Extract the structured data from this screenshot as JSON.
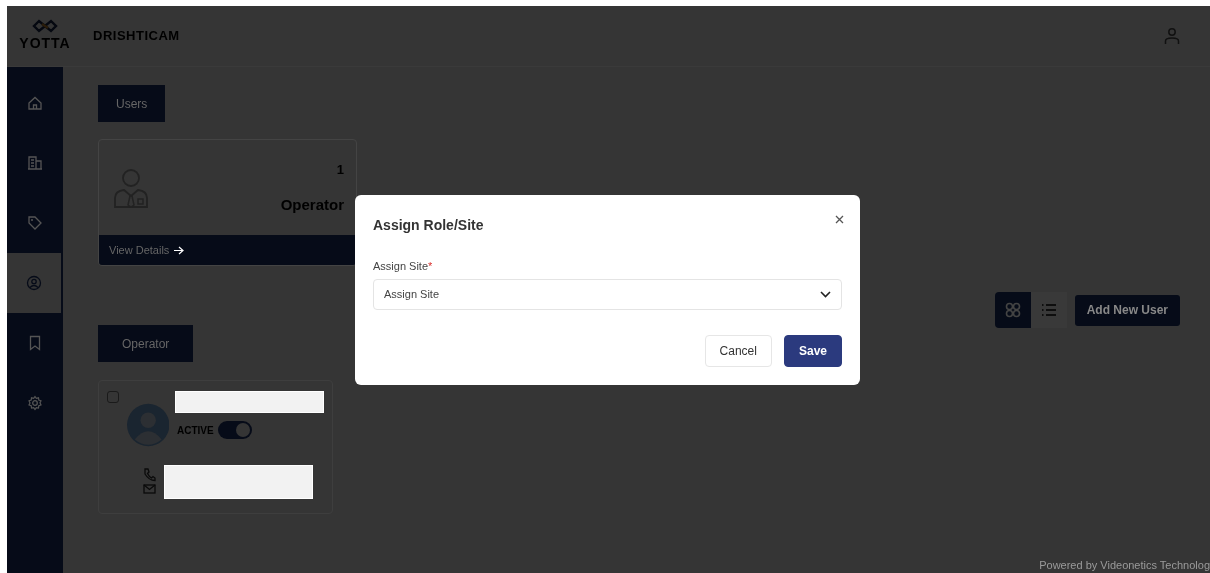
{
  "header": {
    "logo_text": "YOTTA",
    "app_name": "DRISHTICAM"
  },
  "sidebar": {
    "items": [
      {
        "kind": "home",
        "selected": false
      },
      {
        "kind": "building",
        "selected": false
      },
      {
        "kind": "tag",
        "selected": false
      },
      {
        "kind": "user",
        "selected": true
      },
      {
        "kind": "bookmark",
        "selected": false
      },
      {
        "kind": "settings",
        "selected": false
      }
    ]
  },
  "users_heading": "Users",
  "role_card": {
    "count": "1",
    "role": "Operator",
    "link": "View Details"
  },
  "operator_heading": "Operator",
  "view_toggle": [
    {
      "kind": "grid",
      "selected": true
    },
    {
      "kind": "list",
      "selected": false
    }
  ],
  "add_button": "Add New User",
  "user_cards": [
    {
      "checked": false,
      "status": "ACTIVE",
      "active": true
    }
  ],
  "footer": "Powered by Videonetics Technolog",
  "modal": {
    "title": "Assign Role/Site",
    "field_label": "Assign Site",
    "required_mark": "*",
    "placeholder": "Assign Site",
    "buttons": [
      {
        "label": "Cancel",
        "kind": "secondary"
      },
      {
        "label": "Save",
        "kind": "primary"
      }
    ]
  }
}
